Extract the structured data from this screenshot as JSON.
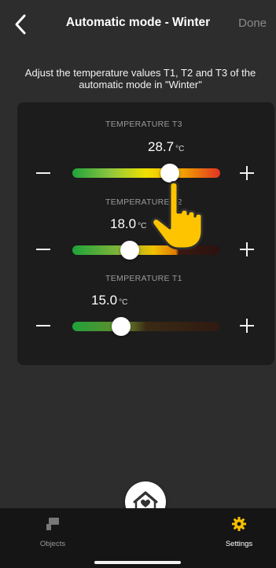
{
  "header": {
    "title": "Automatic mode - Winter",
    "done_label": "Done"
  },
  "description": "Adjust the temperature values T1, T2 and T3 of the automatic mode in \"Winter\"",
  "sliders": [
    {
      "label": "TEMPERATURE T3",
      "value": "28.7",
      "unit": "°C",
      "position": 0.66
    },
    {
      "label": "TEMPERATURE T2",
      "value": "18.0",
      "unit": "°C",
      "position": 0.39
    },
    {
      "label": "TEMPERATURE T1",
      "value": "15.0",
      "unit": "°C",
      "position": 0.33
    }
  ],
  "tabs": [
    {
      "label": "Objects",
      "icon": "objects-icon",
      "active": false
    },
    {
      "label": "Settings",
      "icon": "gear-icon",
      "active": true
    }
  ],
  "colors": {
    "accent": "#f5c000",
    "background": "#2d2d2d",
    "panel": "#1c1c1c",
    "tabbar": "#151515"
  }
}
